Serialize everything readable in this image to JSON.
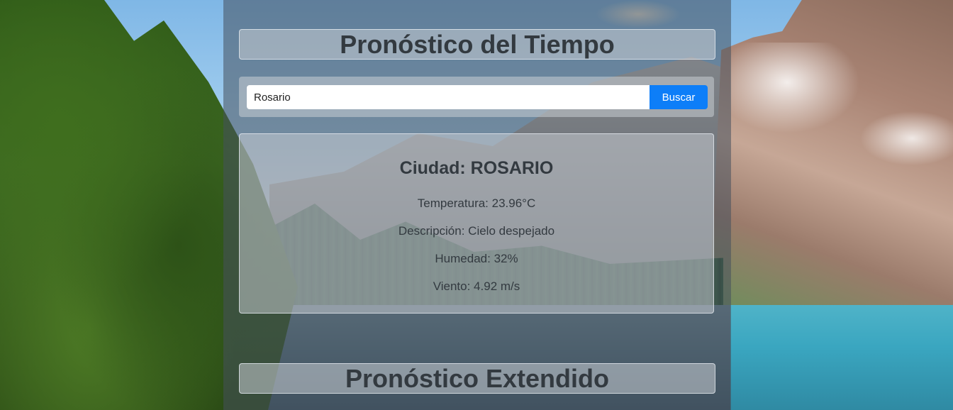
{
  "header": {
    "title": "Pronóstico del Tiempo"
  },
  "search": {
    "value": "Rosario",
    "button_label": "Buscar"
  },
  "weather": {
    "city_line": "Ciudad: ROSARIO",
    "temperature_line": "Temperatura: 23.96°C",
    "description_line": "Descripción: Cielo despejado",
    "humidity_line": "Humedad: 32%",
    "wind_line": "Viento: 4.92 m/s"
  },
  "extended": {
    "title": "Pronóstico Extendido"
  },
  "colors": {
    "accent": "#0d7ef8",
    "text": "#333a40"
  }
}
